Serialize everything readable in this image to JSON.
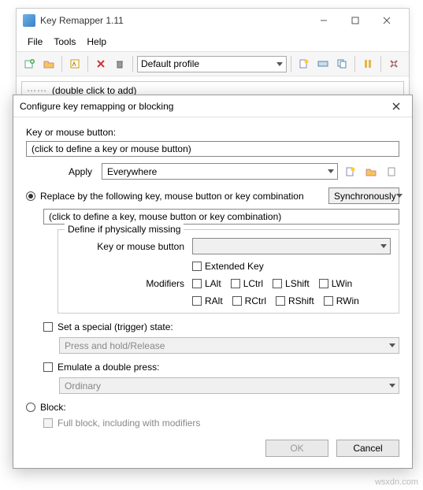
{
  "app": {
    "title": "Key Remapper 1.11",
    "menu": {
      "file": "File",
      "tools": "Tools",
      "help": "Help"
    },
    "profile_select": "Default profile",
    "list_placeholder": "(double click to add)"
  },
  "dialog": {
    "title": "Configure key remapping or blocking",
    "key_label": "Key or mouse button:",
    "key_define_placeholder": "(click to define a key or mouse button)",
    "apply_label": "Apply",
    "apply_value": "Everywhere",
    "replace_label": "Replace by the following key, mouse button or key combination",
    "sync_value": "Synchronously",
    "combo_placeholder": "(click to define a key, mouse button or key combination)",
    "group_title": "Define if physically missing",
    "group_key_label": "Key or mouse button",
    "extended_label": "Extended Key",
    "modifiers_label": "Modifiers",
    "mods1": {
      "lalt": "LAlt",
      "lctrl": "LCtrl",
      "lshift": "LShift",
      "lwin": "LWin"
    },
    "mods2": {
      "ralt": "RAlt",
      "rctrl": "RCtrl",
      "rshift": "RShift",
      "rwin": "RWin"
    },
    "trigger_label": "Set a special (trigger) state:",
    "trigger_value": "Press and hold/Release",
    "double_label": "Emulate a double press:",
    "double_value": "Ordinary",
    "block_label": "Block:",
    "full_block_label": "Full block, including with modifiers",
    "ok": "OK",
    "cancel": "Cancel"
  },
  "watermark": "wsxdn.com"
}
